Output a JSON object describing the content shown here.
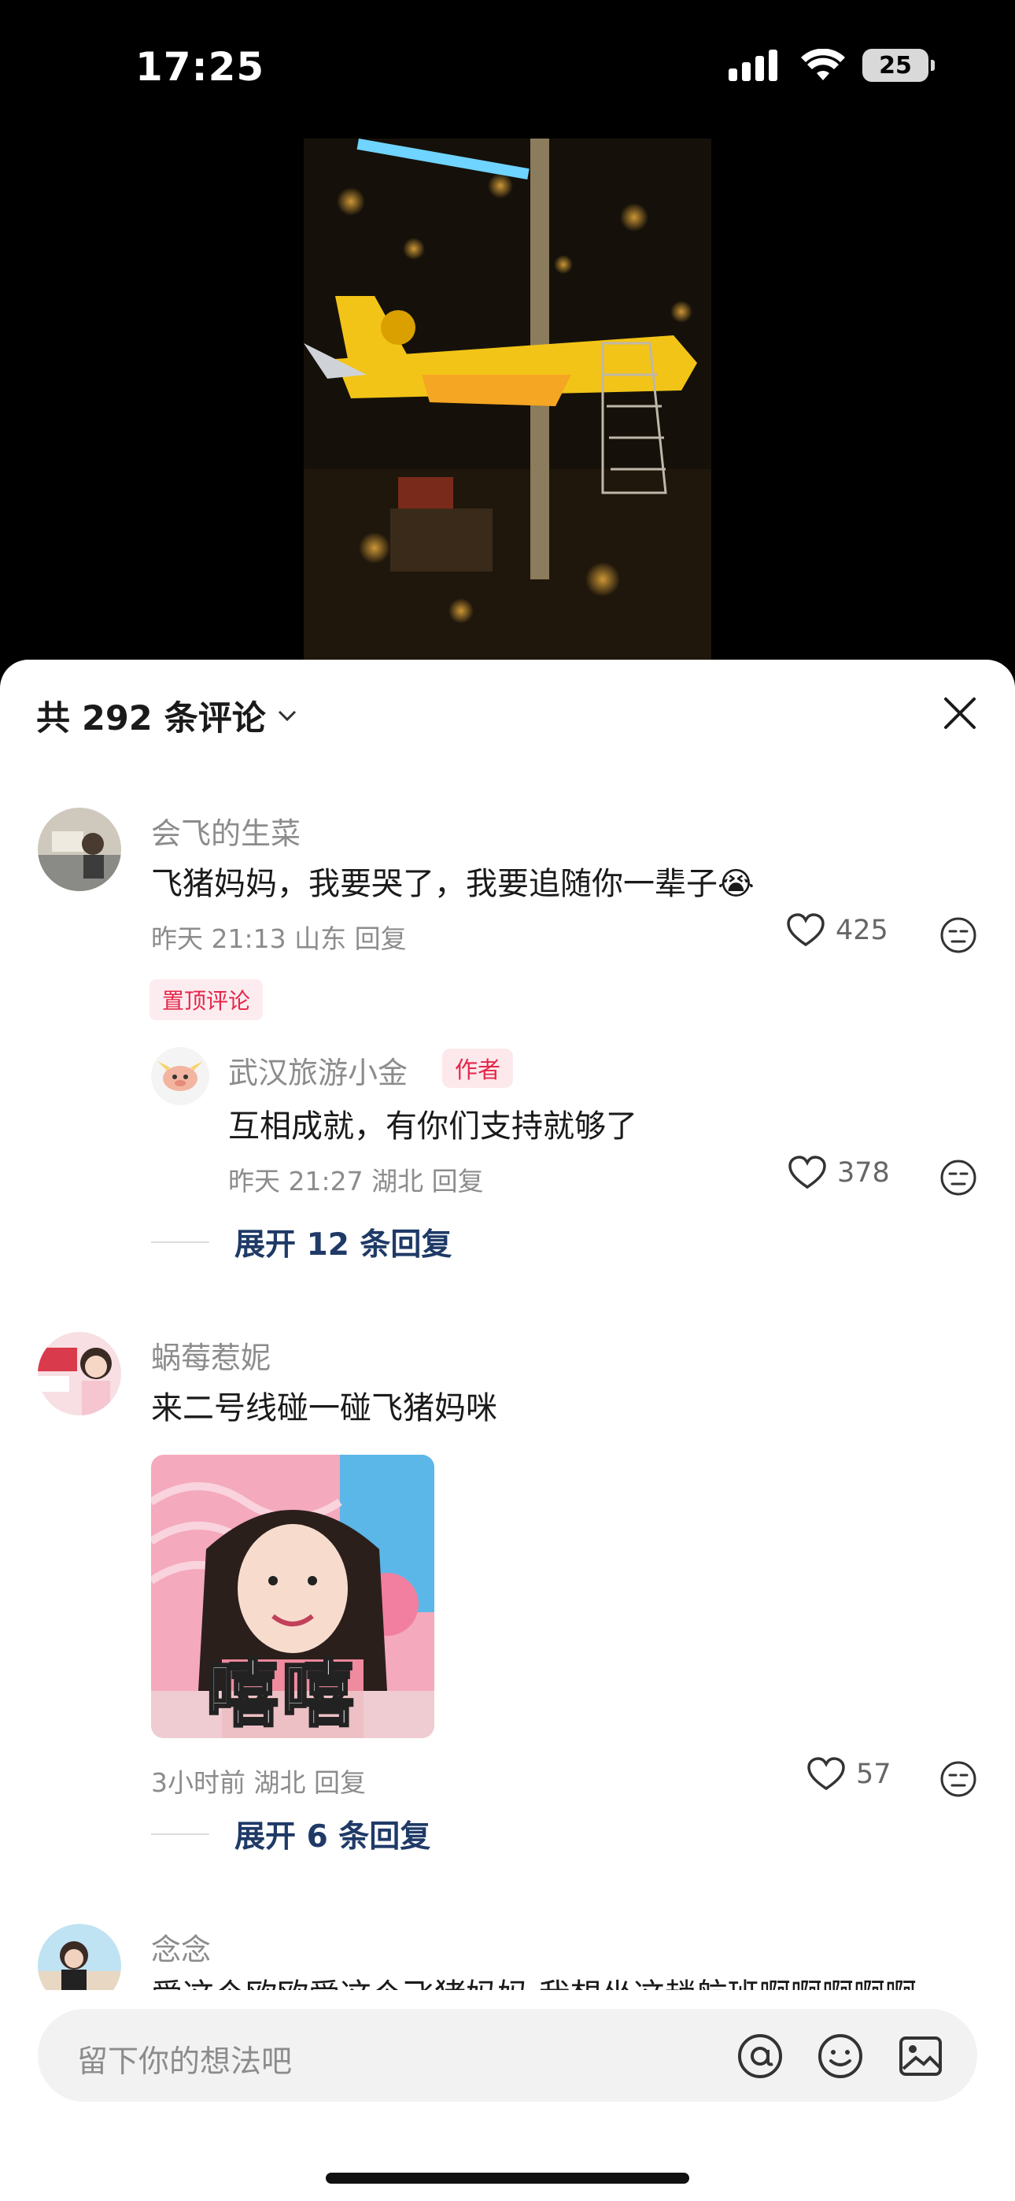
{
  "status_bar": {
    "time": "17:25",
    "battery": "25"
  },
  "comments_header": {
    "title": "共 292 条评论"
  },
  "comments": [
    {
      "username": "会飞的生菜",
      "text": "飞猪妈妈，我要哭了，我要追随你一辈子😭",
      "meta": "昨天 21:13 山东 回复",
      "likes": "425",
      "pinned_label": "置顶评论",
      "reply": {
        "username": "武汉旅游小金",
        "badge": "作者",
        "text": "互相成就，有你们支持就够了",
        "meta": "昨天 21:27 湖北 回复",
        "likes": "378"
      },
      "expand_label": "展开 12 条回复"
    },
    {
      "username": "蜗莓惹妮",
      "text": "来二号线碰一碰飞猪妈咪",
      "sticker_text": "嘻嘻",
      "meta": "3小时前 湖北 回复",
      "likes": "57",
      "expand_label": "展开 6 条回复"
    },
    {
      "username": "念念",
      "text": "爱这个欧欧爱这个飞猪妈妈 我想坐这趟航班啊啊啊啊啊"
    }
  ],
  "input": {
    "placeholder": "留下你的想法吧"
  },
  "colors": {
    "accent": "#e5264a",
    "link": "#1f3a67",
    "airplane": "#f2c417"
  },
  "icons": [
    "signal-icon",
    "wifi-icon",
    "battery-icon",
    "chevron-down-icon",
    "close-icon",
    "heart-icon",
    "dislike-face-icon",
    "at-icon",
    "emoji-icon",
    "image-icon"
  ]
}
